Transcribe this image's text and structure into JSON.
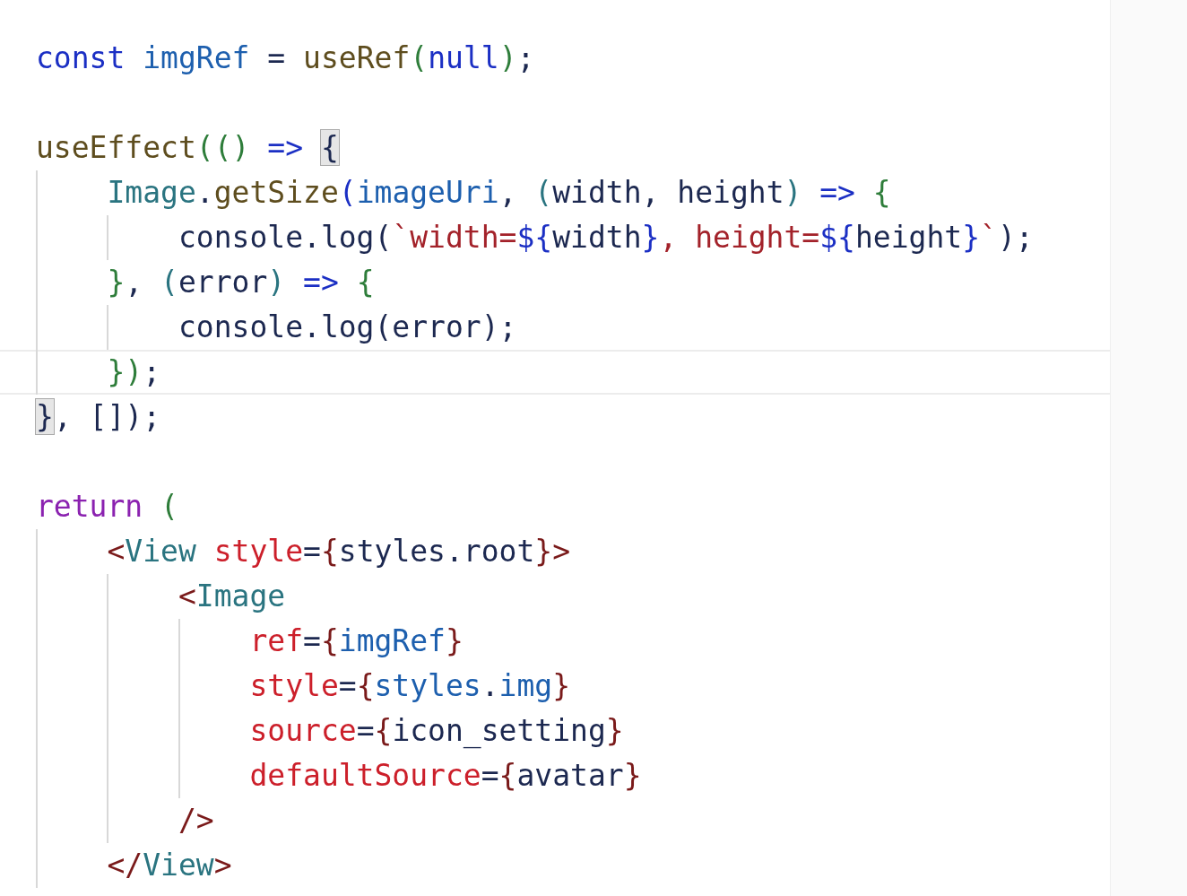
{
  "editor": {
    "lines": [
      {
        "current": false,
        "tokens": [
          {
            "kind": "kw",
            "text": "const "
          },
          {
            "kind": "var",
            "text": "imgRef"
          },
          {
            "kind": "plain",
            "text": " = "
          },
          {
            "kind": "fn",
            "text": "useRef"
          },
          {
            "kind": "paren",
            "text": "("
          },
          {
            "kind": "kw",
            "text": "null"
          },
          {
            "kind": "paren",
            "text": ")"
          },
          {
            "kind": "plain",
            "text": ";"
          }
        ]
      },
      {
        "current": false
      },
      {
        "current": false,
        "tokens": [
          {
            "kind": "fn",
            "text": "useEffect"
          },
          {
            "kind": "paren",
            "text": "(() "
          },
          {
            "kind": "kw",
            "text": "=> "
          },
          {
            "kind": "plain",
            "text": "{",
            "matched": true
          }
        ]
      },
      {
        "current": false,
        "tokens": [
          {
            "kind": "tag",
            "text": "    Image"
          },
          {
            "kind": "plain",
            "text": "."
          },
          {
            "kind": "fn",
            "text": "getSize"
          },
          {
            "kind": "kw",
            "text": "("
          },
          {
            "kind": "var",
            "text": "imageUri"
          },
          {
            "kind": "plain",
            "text": ", "
          },
          {
            "kind": "tag",
            "text": "("
          },
          {
            "kind": "plain",
            "text": "width, height"
          },
          {
            "kind": "tag",
            "text": ") "
          },
          {
            "kind": "kw",
            "text": "=> "
          },
          {
            "kind": "paren",
            "text": "{"
          }
        ]
      },
      {
        "current": false,
        "tokens": [
          {
            "kind": "plain",
            "text": "        console.log("
          },
          {
            "kind": "str",
            "text": "`width="
          },
          {
            "kind": "kw",
            "text": "${"
          },
          {
            "kind": "plain",
            "text": "width"
          },
          {
            "kind": "kw",
            "text": "}"
          },
          {
            "kind": "str",
            "text": ", height="
          },
          {
            "kind": "kw",
            "text": "${"
          },
          {
            "kind": "plain",
            "text": "height"
          },
          {
            "kind": "kw",
            "text": "}"
          },
          {
            "kind": "str",
            "text": "`"
          },
          {
            "kind": "plain",
            "text": ");"
          }
        ]
      },
      {
        "current": false,
        "tokens": [
          {
            "kind": "paren",
            "text": "    }"
          },
          {
            "kind": "plain",
            "text": ", "
          },
          {
            "kind": "tag",
            "text": "("
          },
          {
            "kind": "plain",
            "text": "error"
          },
          {
            "kind": "tag",
            "text": ") "
          },
          {
            "kind": "kw",
            "text": "=> "
          },
          {
            "kind": "paren",
            "text": "{"
          }
        ]
      },
      {
        "current": false,
        "tokens": [
          {
            "kind": "plain",
            "text": "        console.log(error);"
          }
        ]
      },
      {
        "current": true,
        "tokens": [
          {
            "kind": "paren",
            "text": "    })"
          },
          {
            "kind": "plain",
            "text": ";"
          }
        ]
      },
      {
        "current": false,
        "tokens": [
          {
            "kind": "plain",
            "text": "}",
            "matched": true
          },
          {
            "kind": "plain",
            "text": ", []);"
          }
        ]
      },
      {
        "current": false
      },
      {
        "current": false,
        "tokens": [
          {
            "kind": "ret",
            "text": "return "
          },
          {
            "kind": "paren",
            "text": "("
          }
        ]
      },
      {
        "current": false,
        "tokens": [
          {
            "kind": "lt",
            "text": "    <"
          },
          {
            "kind": "tag",
            "text": "View "
          },
          {
            "kind": "attr",
            "text": "style"
          },
          {
            "kind": "plain",
            "text": "="
          },
          {
            "kind": "lt",
            "text": "{"
          },
          {
            "kind": "plain",
            "text": "styles.root"
          },
          {
            "kind": "lt",
            "text": "}>"
          }
        ]
      },
      {
        "current": false,
        "tokens": [
          {
            "kind": "lt",
            "text": "        <"
          },
          {
            "kind": "tag",
            "text": "Image"
          }
        ]
      },
      {
        "current": false,
        "tokens": [
          {
            "kind": "attr",
            "text": "            ref"
          },
          {
            "kind": "plain",
            "text": "="
          },
          {
            "kind": "lt",
            "text": "{"
          },
          {
            "kind": "var",
            "text": "imgRef"
          },
          {
            "kind": "lt",
            "text": "}"
          }
        ]
      },
      {
        "current": false,
        "tokens": [
          {
            "kind": "attr",
            "text": "            style"
          },
          {
            "kind": "plain",
            "text": "="
          },
          {
            "kind": "lt",
            "text": "{"
          },
          {
            "kind": "var",
            "text": "styles"
          },
          {
            "kind": "plain",
            "text": "."
          },
          {
            "kind": "var",
            "text": "img"
          },
          {
            "kind": "lt",
            "text": "}"
          }
        ]
      },
      {
        "current": false,
        "tokens": [
          {
            "kind": "attr",
            "text": "            source"
          },
          {
            "kind": "plain",
            "text": "="
          },
          {
            "kind": "lt",
            "text": "{"
          },
          {
            "kind": "plain",
            "text": "icon_setting"
          },
          {
            "kind": "lt",
            "text": "}"
          }
        ]
      },
      {
        "current": false,
        "tokens": [
          {
            "kind": "attr",
            "text": "            defaultSource"
          },
          {
            "kind": "plain",
            "text": "="
          },
          {
            "kind": "lt",
            "text": "{"
          },
          {
            "kind": "plain",
            "text": "avatar"
          },
          {
            "kind": "lt",
            "text": "}"
          }
        ]
      },
      {
        "current": false,
        "tokens": [
          {
            "kind": "lt",
            "text": "        />"
          }
        ]
      },
      {
        "current": false,
        "tokens": [
          {
            "kind": "lt",
            "text": "    </"
          },
          {
            "kind": "tag",
            "text": "View"
          },
          {
            "kind": "lt",
            "text": ">"
          }
        ]
      }
    ]
  }
}
